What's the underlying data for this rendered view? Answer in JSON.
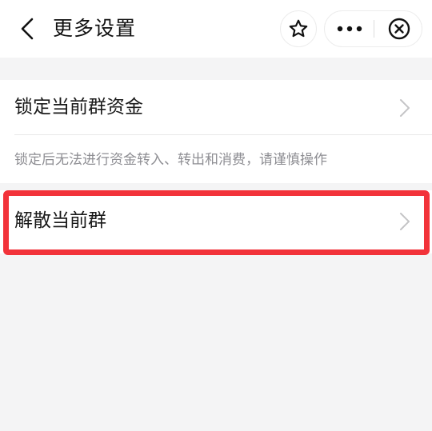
{
  "header": {
    "title": "更多设置",
    "icons": {
      "back": "chevron-left-icon",
      "favorite": "star-icon",
      "more": "more-dots-icon",
      "close": "close-circle-icon"
    }
  },
  "settings": {
    "lock_funds": {
      "label": "锁定当前群资金",
      "hint": "锁定后无法进行资金转入、转出和消费，请谨慎操作"
    },
    "dissolve_group": {
      "label": "解散当前群"
    }
  },
  "colors": {
    "highlight_border": "#f2333a",
    "background": "#f4f4f5",
    "hint_text": "#8e8e93"
  }
}
